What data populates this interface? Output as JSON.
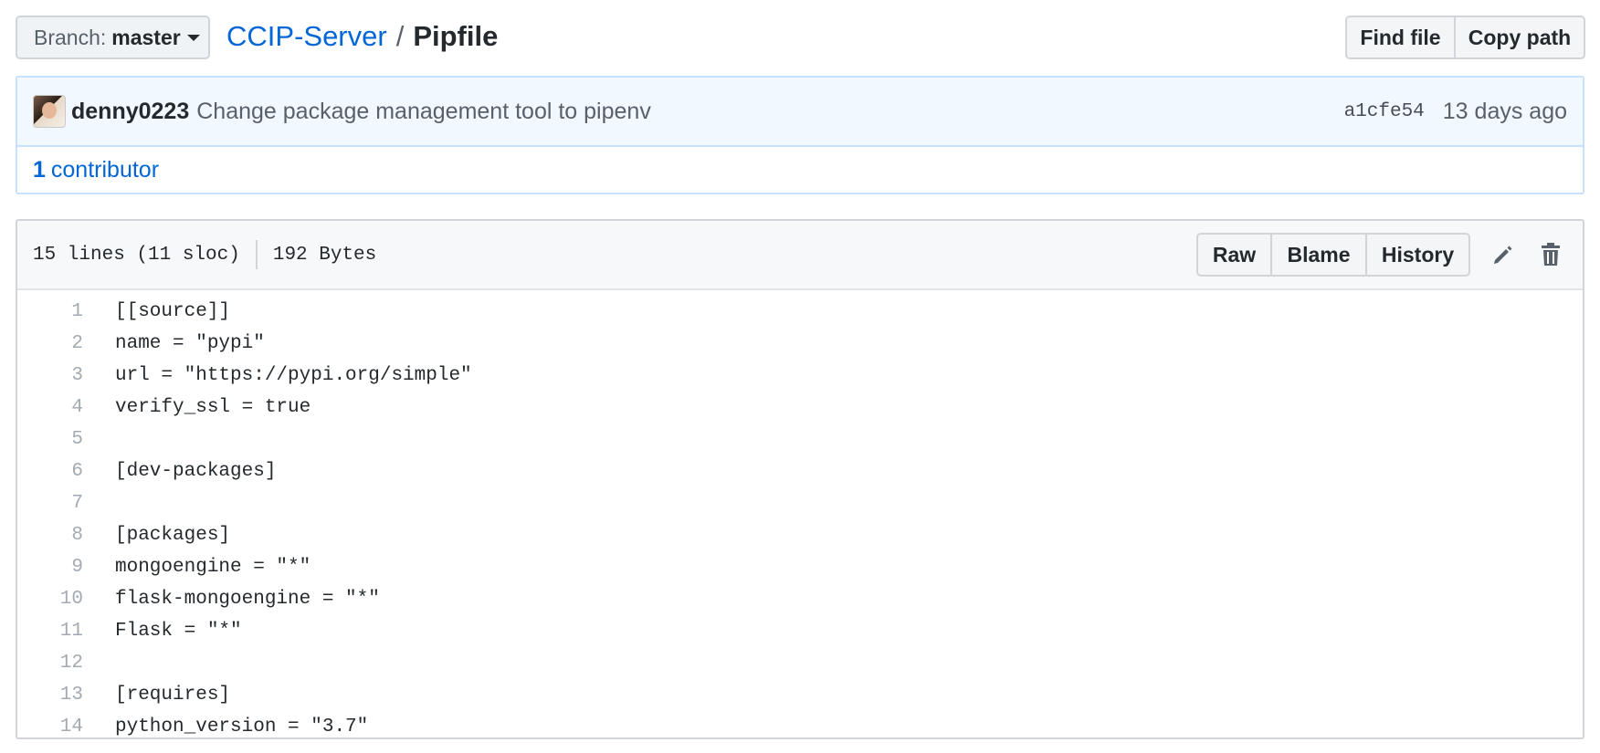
{
  "branch": {
    "prefix": "Branch:",
    "name": "master"
  },
  "breadcrumb": {
    "repo": "CCIP-Server",
    "separator": "/",
    "file": "Pipfile"
  },
  "top_actions": {
    "find_file": "Find file",
    "copy_path": "Copy path"
  },
  "commit": {
    "author": "denny0223",
    "message": "Change package management tool to pipenv",
    "sha": "a1cfe54",
    "age": "13 days ago"
  },
  "contributors": {
    "count": "1",
    "label": "contributor"
  },
  "file": {
    "lines_info": "15 lines (11 sloc)",
    "size": "192 Bytes",
    "actions": {
      "raw": "Raw",
      "blame": "Blame",
      "history": "History"
    },
    "icons": [
      "pencil-icon",
      "trash-icon"
    ]
  },
  "code_lines": [
    {
      "num": "1",
      "text": "[[source]]"
    },
    {
      "num": "2",
      "text": "name = \"pypi\""
    },
    {
      "num": "3",
      "text": "url = \"https://pypi.org/simple\""
    },
    {
      "num": "4",
      "text": "verify_ssl = true"
    },
    {
      "num": "5",
      "text": ""
    },
    {
      "num": "6",
      "text": "[dev-packages]"
    },
    {
      "num": "7",
      "text": ""
    },
    {
      "num": "8",
      "text": "[packages]"
    },
    {
      "num": "9",
      "text": "mongoengine = \"*\""
    },
    {
      "num": "10",
      "text": "flask-mongoengine = \"*\""
    },
    {
      "num": "11",
      "text": "Flask = \"*\""
    },
    {
      "num": "12",
      "text": ""
    },
    {
      "num": "13",
      "text": "[requires]"
    },
    {
      "num": "14",
      "text": "python_version = \"3.7\""
    }
  ]
}
